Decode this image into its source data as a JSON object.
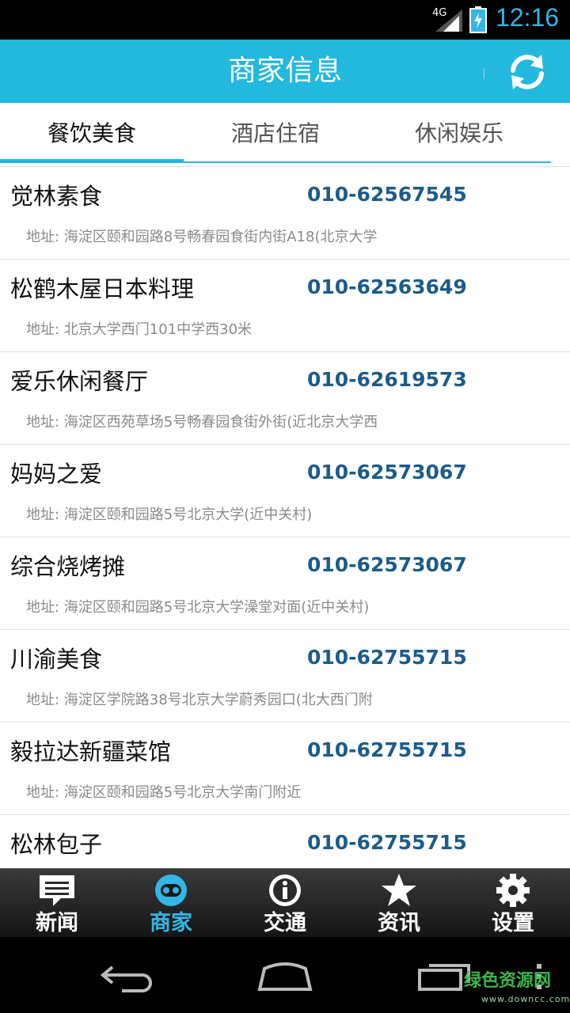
{
  "status_bar": {
    "network": "4G",
    "time": "12:16"
  },
  "header": {
    "title": "商家信息",
    "refresh_icon": "refresh-icon"
  },
  "tabs": [
    {
      "label": "餐饮美食",
      "active": true
    },
    {
      "label": "酒店住宿",
      "active": false
    },
    {
      "label": "休闲娱乐",
      "active": false
    }
  ],
  "list": [
    {
      "name": "觉林素食",
      "phone": "010-62567545",
      "address": "地址: 海淀区颐和园路8号畅春园食街内街A18(北京大学"
    },
    {
      "name": "松鹤木屋日本料理",
      "phone": "010-62563649",
      "address": "地址: 北京大学西门101中学西30米"
    },
    {
      "name": "爱乐休闲餐厅",
      "phone": "010-62619573",
      "address": "地址: 海淀区西苑草场5号畅春园食街外街(近北京大学西"
    },
    {
      "name": "妈妈之爱",
      "phone": "010-62573067",
      "address": "地址: 海淀区颐和园路5号北京大学(近中关村)"
    },
    {
      "name": "综合烧烤摊",
      "phone": "010-62573067",
      "address": "地址: 海淀区颐和园路5号北京大学澡堂对面(近中关村)"
    },
    {
      "name": "川渝美食",
      "phone": "010-62755715",
      "address": "地址: 海淀区学院路38号北京大学蔚秀园口(北大西门附"
    },
    {
      "name": "毅拉达新疆菜馆",
      "phone": "010-62755715",
      "address": "地址: 海淀区颐和园路5号北京大学南门附近"
    },
    {
      "name": "松林包子",
      "phone": "010-62755715",
      "address": ""
    }
  ],
  "bottom_nav": [
    {
      "label": "新闻",
      "icon": "chat-bubble-icon",
      "active": false
    },
    {
      "label": "商家",
      "icon": "smiley-icon",
      "active": true
    },
    {
      "label": "交通",
      "icon": "info-icon",
      "active": false
    },
    {
      "label": "资讯",
      "icon": "star-icon",
      "active": false
    },
    {
      "label": "设置",
      "icon": "gear-icon",
      "active": false
    }
  ],
  "watermark": {
    "text": "绿色资源网",
    "sub": "www.downcc.com"
  },
  "colors": {
    "accent": "#23b8de",
    "phone": "#1d5c8a",
    "active_nav": "#33b5e5"
  }
}
